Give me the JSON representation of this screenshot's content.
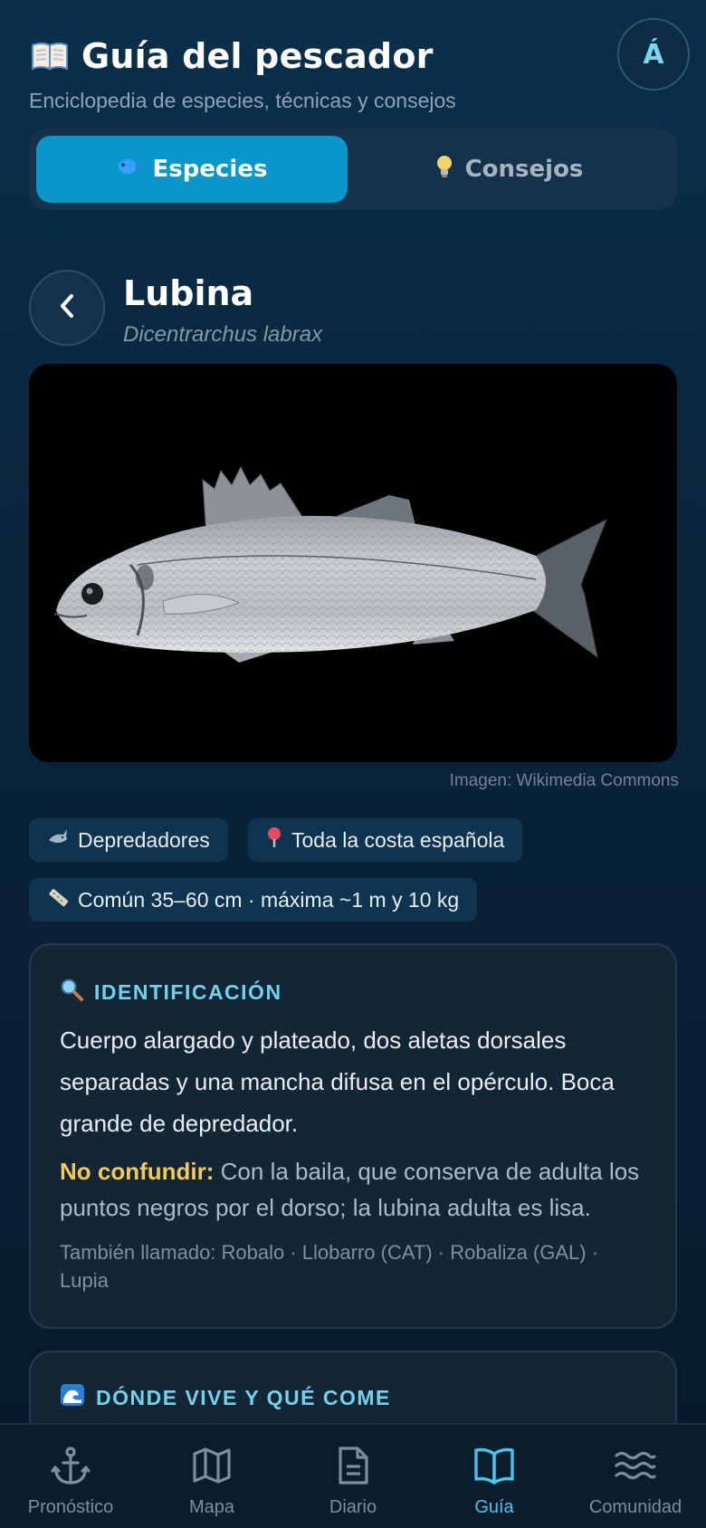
{
  "header": {
    "title": "Guía del pescador",
    "subtitle": "Enciclopedia de especies, técnicas y consejos",
    "lang_button": "Á",
    "title_icon": "open-book-icon"
  },
  "tabs": [
    {
      "label": "Especies",
      "icon": "fish-icon",
      "active": true
    },
    {
      "label": "Consejos",
      "icon": "lightbulb-icon",
      "active": false
    }
  ],
  "species": {
    "name": "Lubina",
    "scientific_name": "Dicentrarchus labrax",
    "image_credit": "Imagen: Wikimedia Commons",
    "tags": [
      {
        "icon": "shark-icon",
        "label": "Depredadores"
      },
      {
        "icon": "pin-icon",
        "label": "Toda la costa española"
      },
      {
        "icon": "ruler-icon",
        "label": "Común 35–60 cm · máxima ~1 m y 10 kg"
      }
    ]
  },
  "identification": {
    "icon": "magnifier-icon",
    "heading": "IDENTIFICACIÓN",
    "description": "Cuerpo alargado y plateado, dos aletas dorsales separadas y una mancha difusa en el opérculo. Boca grande de depredador.",
    "warning_label": "No confundir:",
    "warning_text": "Con la baila, que conserva de adulta los puntos negros por el dorso; la lubina adulta es lisa.",
    "aka": "También llamado: Robalo · Llobarro (CAT) · Robaliza (GAL) · Lupia"
  },
  "habitat": {
    "icon": "wave-icon",
    "heading": "DÓNDE VIVE Y QUÉ COME"
  },
  "nav": [
    {
      "label": "Pronóstico",
      "icon": "anchor-icon",
      "active": false
    },
    {
      "label": "Mapa",
      "icon": "map-icon",
      "active": false
    },
    {
      "label": "Diario",
      "icon": "document-icon",
      "active": false
    },
    {
      "label": "Guía",
      "icon": "book-icon",
      "active": true
    },
    {
      "label": "Comunidad",
      "icon": "waves-icon",
      "active": false
    }
  ],
  "colors": {
    "accent": "#0897c8",
    "accent_text": "#74d1ee",
    "warning": "#f6c95a",
    "background": "#0a2840"
  }
}
